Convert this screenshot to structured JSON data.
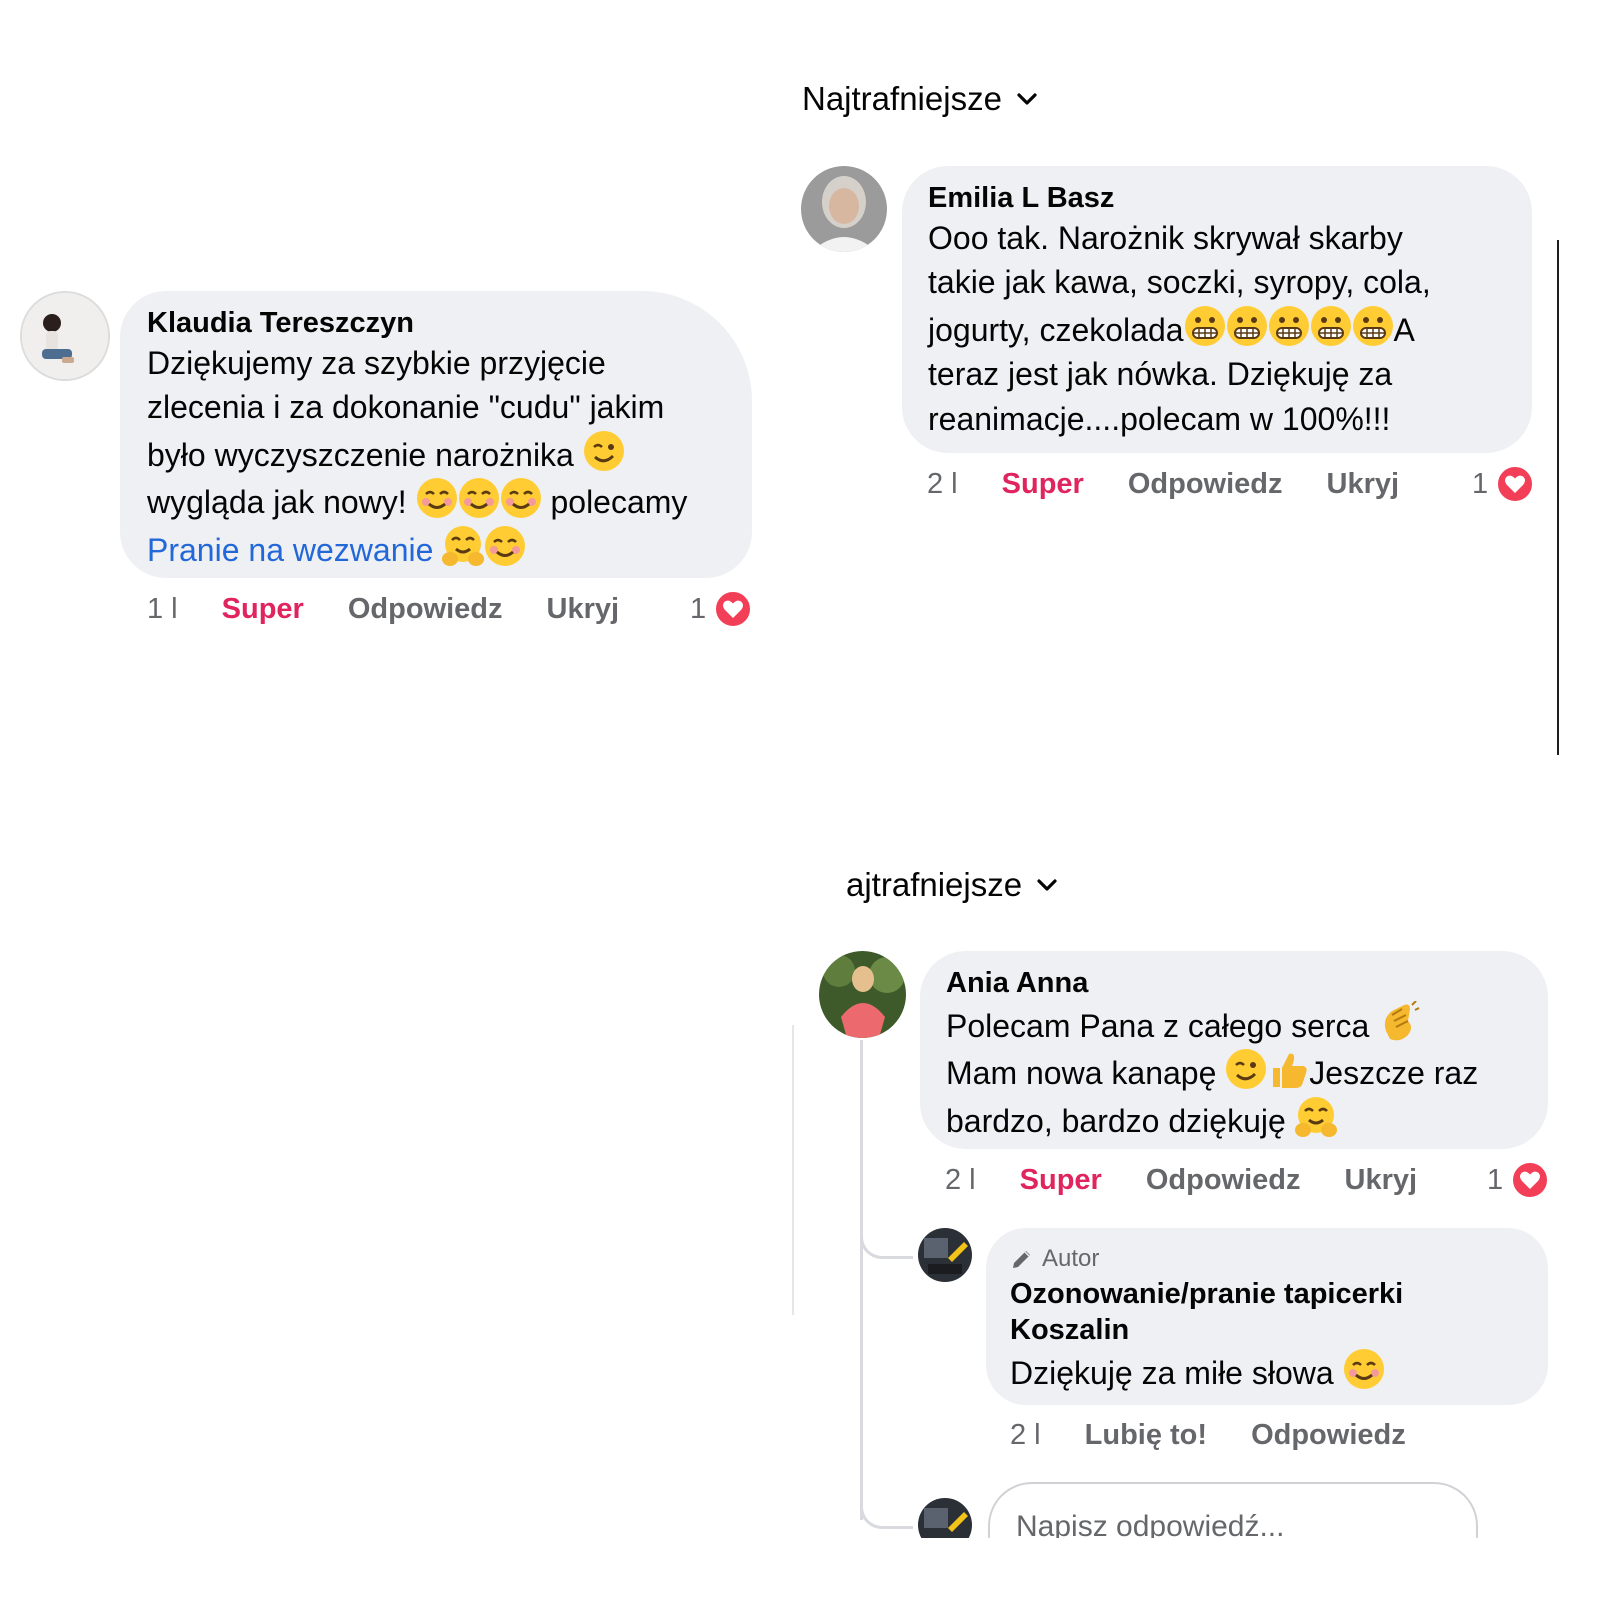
{
  "sort": {
    "label_1": "Najtrafniejsze",
    "label_2": "ajtrafniejsze"
  },
  "comments": [
    {
      "author": "Klaudia Tereszczyn",
      "lines": [
        "Dziękujemy za szybkie przyjęcie",
        "zlecenia i za dokonanie \"cudu\" jakim",
        "było wyczyszczenie narożnika",
        "wygląda jak nowy!",
        "polecamy"
      ],
      "link": "Pranie na wezwanie",
      "time": "1 l",
      "reaction_label": "Super",
      "reply_label": "Odpowiedz",
      "hide_label": "Ukryj",
      "reaction_count": "1"
    },
    {
      "author": "Emilia L Basz",
      "lines": [
        "Ooo tak. Narożnik skrywał skarby",
        "takie jak  kawa, soczki, syropy, cola,",
        "jogurty, czekolada",
        "A",
        "teraz jest jak nówka. Dziękuję za",
        "reanimacje....polecam w  100%!!!"
      ],
      "time": "2 l",
      "reaction_label": "Super",
      "reply_label": "Odpowiedz",
      "hide_label": "Ukryj",
      "reaction_count": "1"
    },
    {
      "author": "Ania Anna",
      "lines": [
        "Polecam Pana z całego serca",
        "Mam nowa kanapę",
        "Jeszcze raz",
        "bardzo, bardzo dziękuję"
      ],
      "time": "2 l",
      "reaction_label": "Super",
      "reply_label": "Odpowiedz",
      "hide_label": "Ukryj",
      "reaction_count": "1"
    }
  ],
  "reply": {
    "badge": "Autor",
    "author_line1": "Ozonowanie/pranie tapicerki",
    "author_line2": "Koszalin",
    "text": "Dziękuję za miłe słowa",
    "time": "2 l",
    "like_label": "Lubię to!",
    "reply_label": "Odpowiedz"
  },
  "reply_input": {
    "placeholder": "Napisz odpowiedź..."
  },
  "colors": {
    "bubble": "#eff0f3",
    "super": "#e0245e",
    "link": "#2368d8",
    "muted": "#65676b"
  }
}
